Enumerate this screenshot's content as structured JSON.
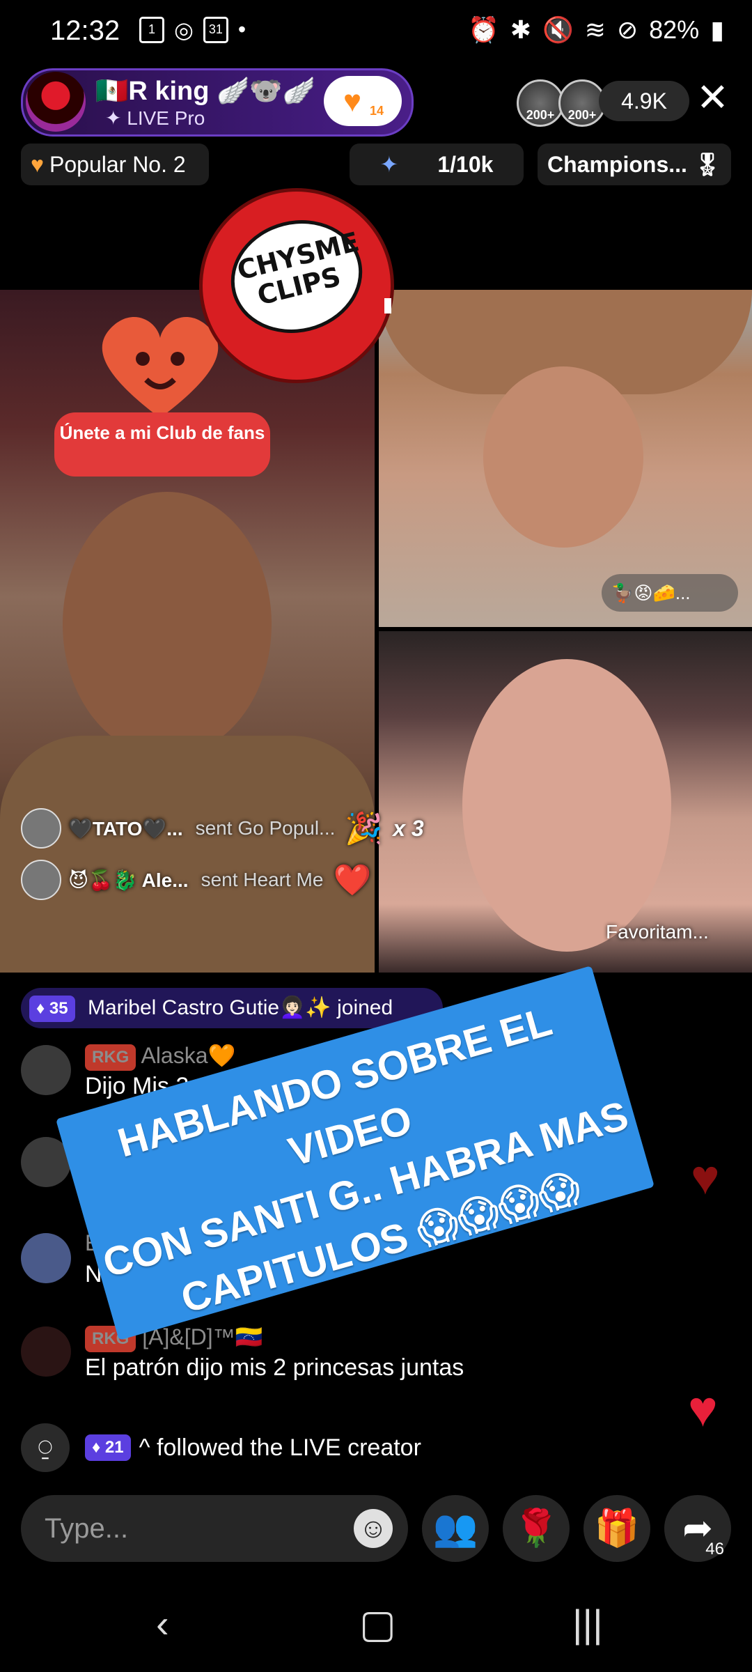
{
  "status_bar": {
    "time": "12:32",
    "battery": "82%",
    "icons": [
      "calendar-icon",
      "whatsapp-icon",
      "calendar-31-icon",
      "dot-icon",
      "alarm-icon",
      "bluetooth-icon",
      "mute-icon",
      "wifi-icon",
      "no-disturb-icon",
      "battery-icon"
    ]
  },
  "host": {
    "name": "🇲🇽R king 🪽🐨🪽",
    "subtitle": "✦ LIVE Pro",
    "follow_count": "14"
  },
  "viewers": {
    "avatar_badges": [
      "200+",
      "200+"
    ],
    "count": "4.9K"
  },
  "tags": {
    "popular": "Popular No. 2",
    "gift_progress": "1/10k",
    "champions": "Champions..."
  },
  "sticker": {
    "line1": "CHYSME",
    "line2": "CLIPS"
  },
  "club_badge": "Únete a mi Club de fans",
  "reaction_pill": "🦆😡🧀...",
  "guest_label": "Favoritam...",
  "gifts": [
    {
      "user": "🖤TATO🖤...",
      "action": "sent Go Popul...",
      "icon": "🎉",
      "multiplier": "x 3"
    },
    {
      "user": "😈🍒🐉 Ale...",
      "action": "sent Heart Me",
      "icon": "❤️",
      "multiplier": ""
    }
  ],
  "join_notice": {
    "level": "35",
    "text": "Maribel Castro Gutie👩🏻‍🦱✨ joined"
  },
  "chat": [
    {
      "badge": "RKG",
      "user": "Alaska🧡",
      "message": "Dijo Mis 2 princ"
    },
    {
      "badge": "",
      "user": "",
      "message": ""
    },
    {
      "badge": "",
      "user": "Ed",
      "message": "No quie"
    },
    {
      "badge": "RKG",
      "user": "[A]&[D]™🇻🇪",
      "message": "El patrón dijo mis 2 princesas juntas"
    }
  ],
  "follow_notice": {
    "level": "21",
    "text": "^ followed the LIVE creator"
  },
  "overlay_banner": {
    "line1": "HABLANDO SOBRE EL VIDEO",
    "line2": "CON SANTI G.. HABRA MAS",
    "line3": "CAPITULOS 😱😱😱😱"
  },
  "input": {
    "placeholder": "Type..."
  },
  "share_count": "46",
  "colors": {
    "banner": "#2f8fe6",
    "host_pill": "#3b1870",
    "heart": "#e8203a"
  }
}
